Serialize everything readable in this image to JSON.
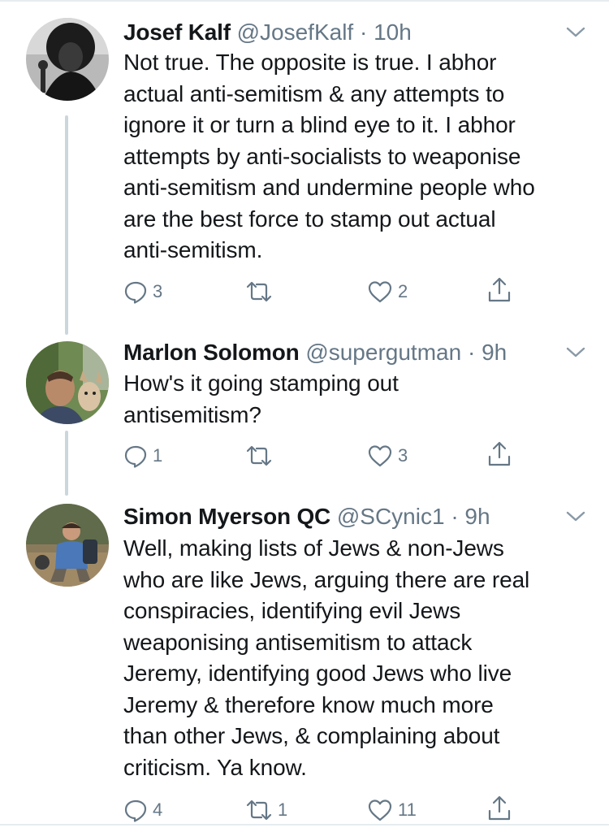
{
  "tweets": [
    {
      "name": "Josef Kalf",
      "handle": "@JosefKalf",
      "separator": "·",
      "time": "10h",
      "lines": [
        "Not true. The opposite is true. I abhor",
        "actual anti-semitism & any attempts to",
        "ignore it or turn a blind eye to it. I abhor",
        "attempts by anti-socialists to weaponise",
        "anti-semitism and undermine people who",
        "are the best force to stamp out actual",
        "anti-semitism."
      ],
      "replies": "3",
      "retweets": "",
      "likes": "2"
    },
    {
      "name": "Marlon Solomon",
      "handle": "@supergutman",
      "separator": "·",
      "time": "9h",
      "lines": [
        "How's it going stamping out",
        "antisemitism?"
      ],
      "replies": "1",
      "retweets": "",
      "likes": "3"
    },
    {
      "name": "Simon Myerson QC",
      "handle": "@SCynic1",
      "separator": "·",
      "time": "9h",
      "lines": [
        "Well, making lists of Jews & non-Jews",
        "who are like Jews, arguing there are real",
        "conspiracies, identifying evil Jews",
        "weaponising antisemitism to attack",
        "Jeremy, identifying good Jews who live",
        "Jeremy & therefore know much more",
        "than other Jews, & complaining about",
        "criticism. Ya know."
      ],
      "replies": "4",
      "retweets": "1",
      "likes": "11"
    }
  ],
  "icons": {
    "reply": "reply-icon",
    "retweet": "retweet-icon",
    "like": "heart-icon",
    "share": "share-icon",
    "menu": "chevron-down-icon"
  },
  "colors": {
    "text": "#14171a",
    "secondary": "#657786",
    "thread_line": "#ccd6dd",
    "divider": "#e6ecf0"
  }
}
